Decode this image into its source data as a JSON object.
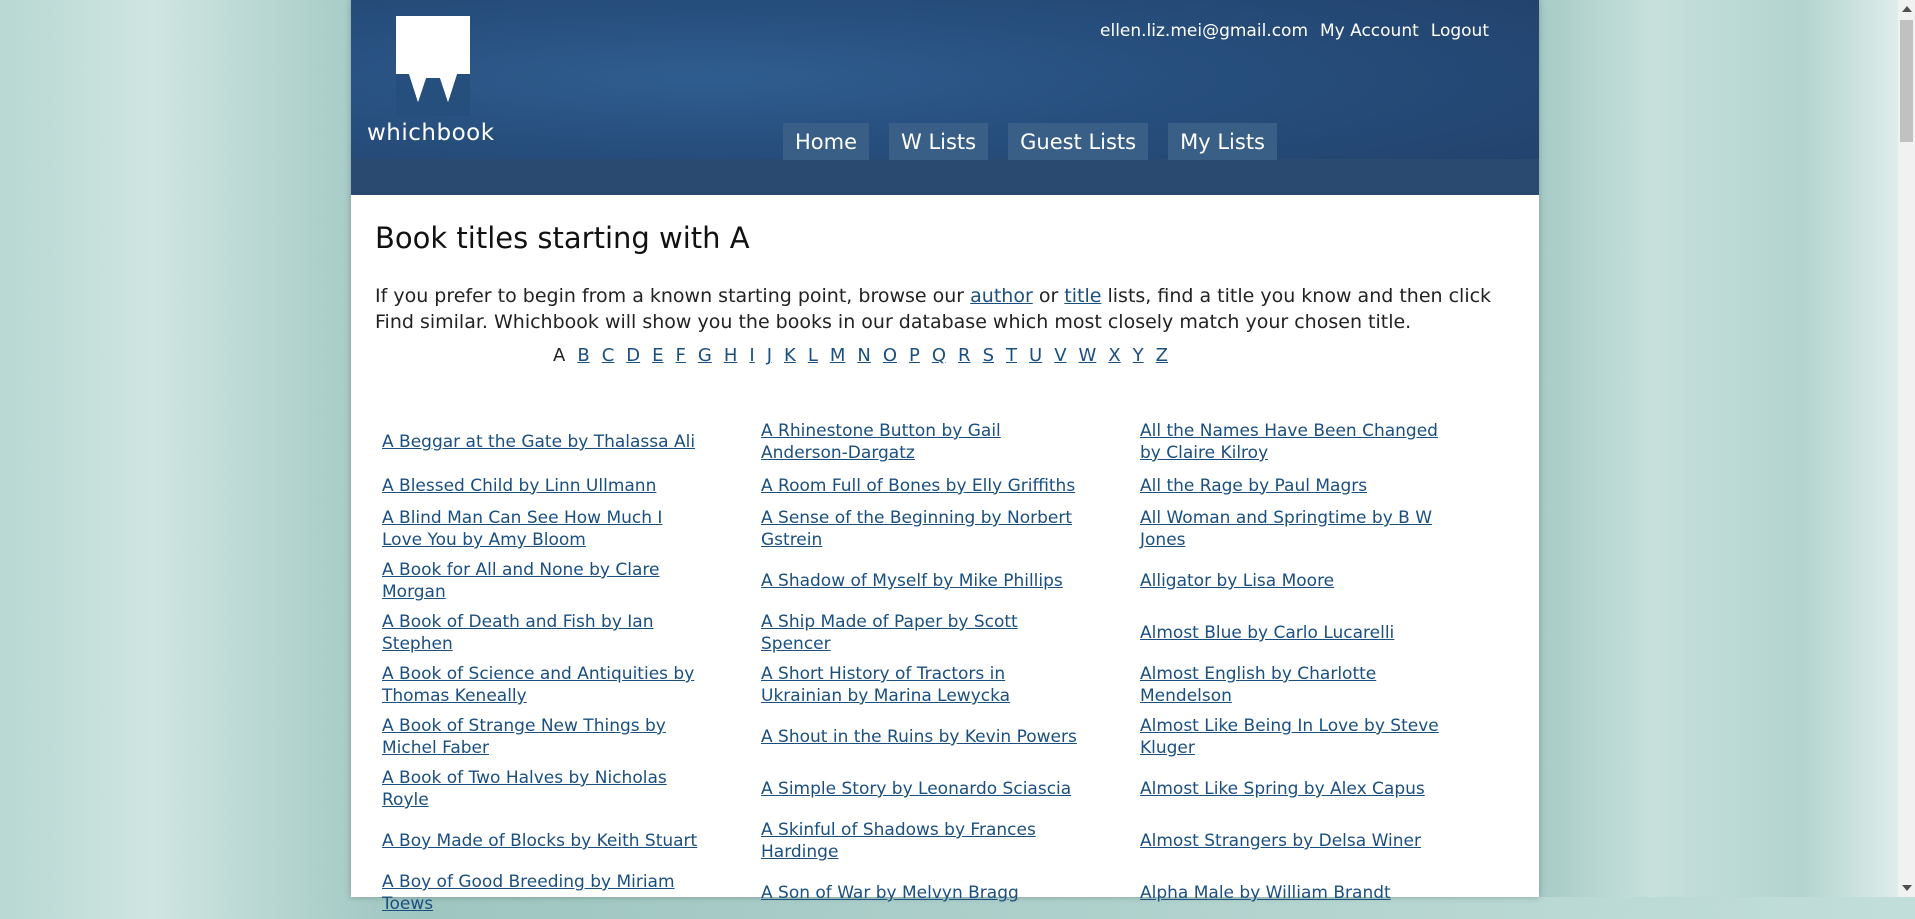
{
  "brand": {
    "wordmark": "whichbook",
    "header_color": "#274f7e"
  },
  "user": {
    "email": "ellen.liz.mei@gmail.com",
    "account": "My Account",
    "logout": "Logout"
  },
  "nav": [
    "Home",
    "W Lists",
    "Guest Lists",
    "My Lists"
  ],
  "page": {
    "title": "Book titles starting with A",
    "intro_before": "If you prefer to begin from a known starting point, browse our ",
    "intro_author": "author",
    "intro_mid": " or ",
    "intro_title": "title",
    "intro_after": " lists, find a title you know and then click Find similar. Whichbook will show you the books in our database which most closely match your chosen title."
  },
  "alphabet": {
    "current": "A",
    "letters": [
      "B",
      "C",
      "D",
      "E",
      "F",
      "G",
      "H",
      "I",
      "J",
      "K",
      "L",
      "M",
      "N",
      "O",
      "P",
      "Q",
      "R",
      "S",
      "T",
      "U",
      "V",
      "W",
      "X",
      "Y",
      "Z"
    ]
  },
  "books": [
    [
      "A Beggar at the Gate by Thalassa Ali",
      "A Rhinestone Button by Gail Anderson-Dargatz",
      "All the Names Have Been Changed by Claire Kilroy"
    ],
    [
      "A Blessed Child by Linn Ullmann",
      "A Room Full of Bones by Elly Griffiths",
      "All the Rage by Paul Magrs"
    ],
    [
      "A Blind Man Can See How Much I Love You by Amy Bloom",
      "A Sense of the Beginning by Norbert Gstrein",
      "All Woman and Springtime by B W Jones"
    ],
    [
      "A Book for All and None by Clare Morgan",
      "A Shadow of Myself by Mike Phillips",
      "Alligator by Lisa Moore"
    ],
    [
      "A Book of Death and Fish by Ian Stephen",
      "A Ship Made of Paper by Scott Spencer",
      "Almost Blue by Carlo Lucarelli"
    ],
    [
      "A Book of Science and Antiquities by Thomas Keneally",
      "A Short History of Tractors in Ukrainian by Marina Lewycka",
      "Almost English by Charlotte Mendelson"
    ],
    [
      "A Book of Strange New Things by Michel Faber",
      "A Shout in the Ruins by Kevin Powers",
      "Almost Like Being In Love by Steve Kluger"
    ],
    [
      "A Book of Two Halves by Nicholas Royle",
      "A Simple Story by Leonardo Sciascia",
      "Almost Like Spring by Alex Capus"
    ],
    [
      "A Boy Made of Blocks by Keith Stuart",
      "A Skinful of Shadows by Frances Hardinge",
      "Almost Strangers by Delsa Winer"
    ],
    [
      "A Boy of Good Breeding by Miriam Toews",
      "A Son of War by Melvyn Bragg",
      "Alpha Male by William Brandt"
    ]
  ]
}
